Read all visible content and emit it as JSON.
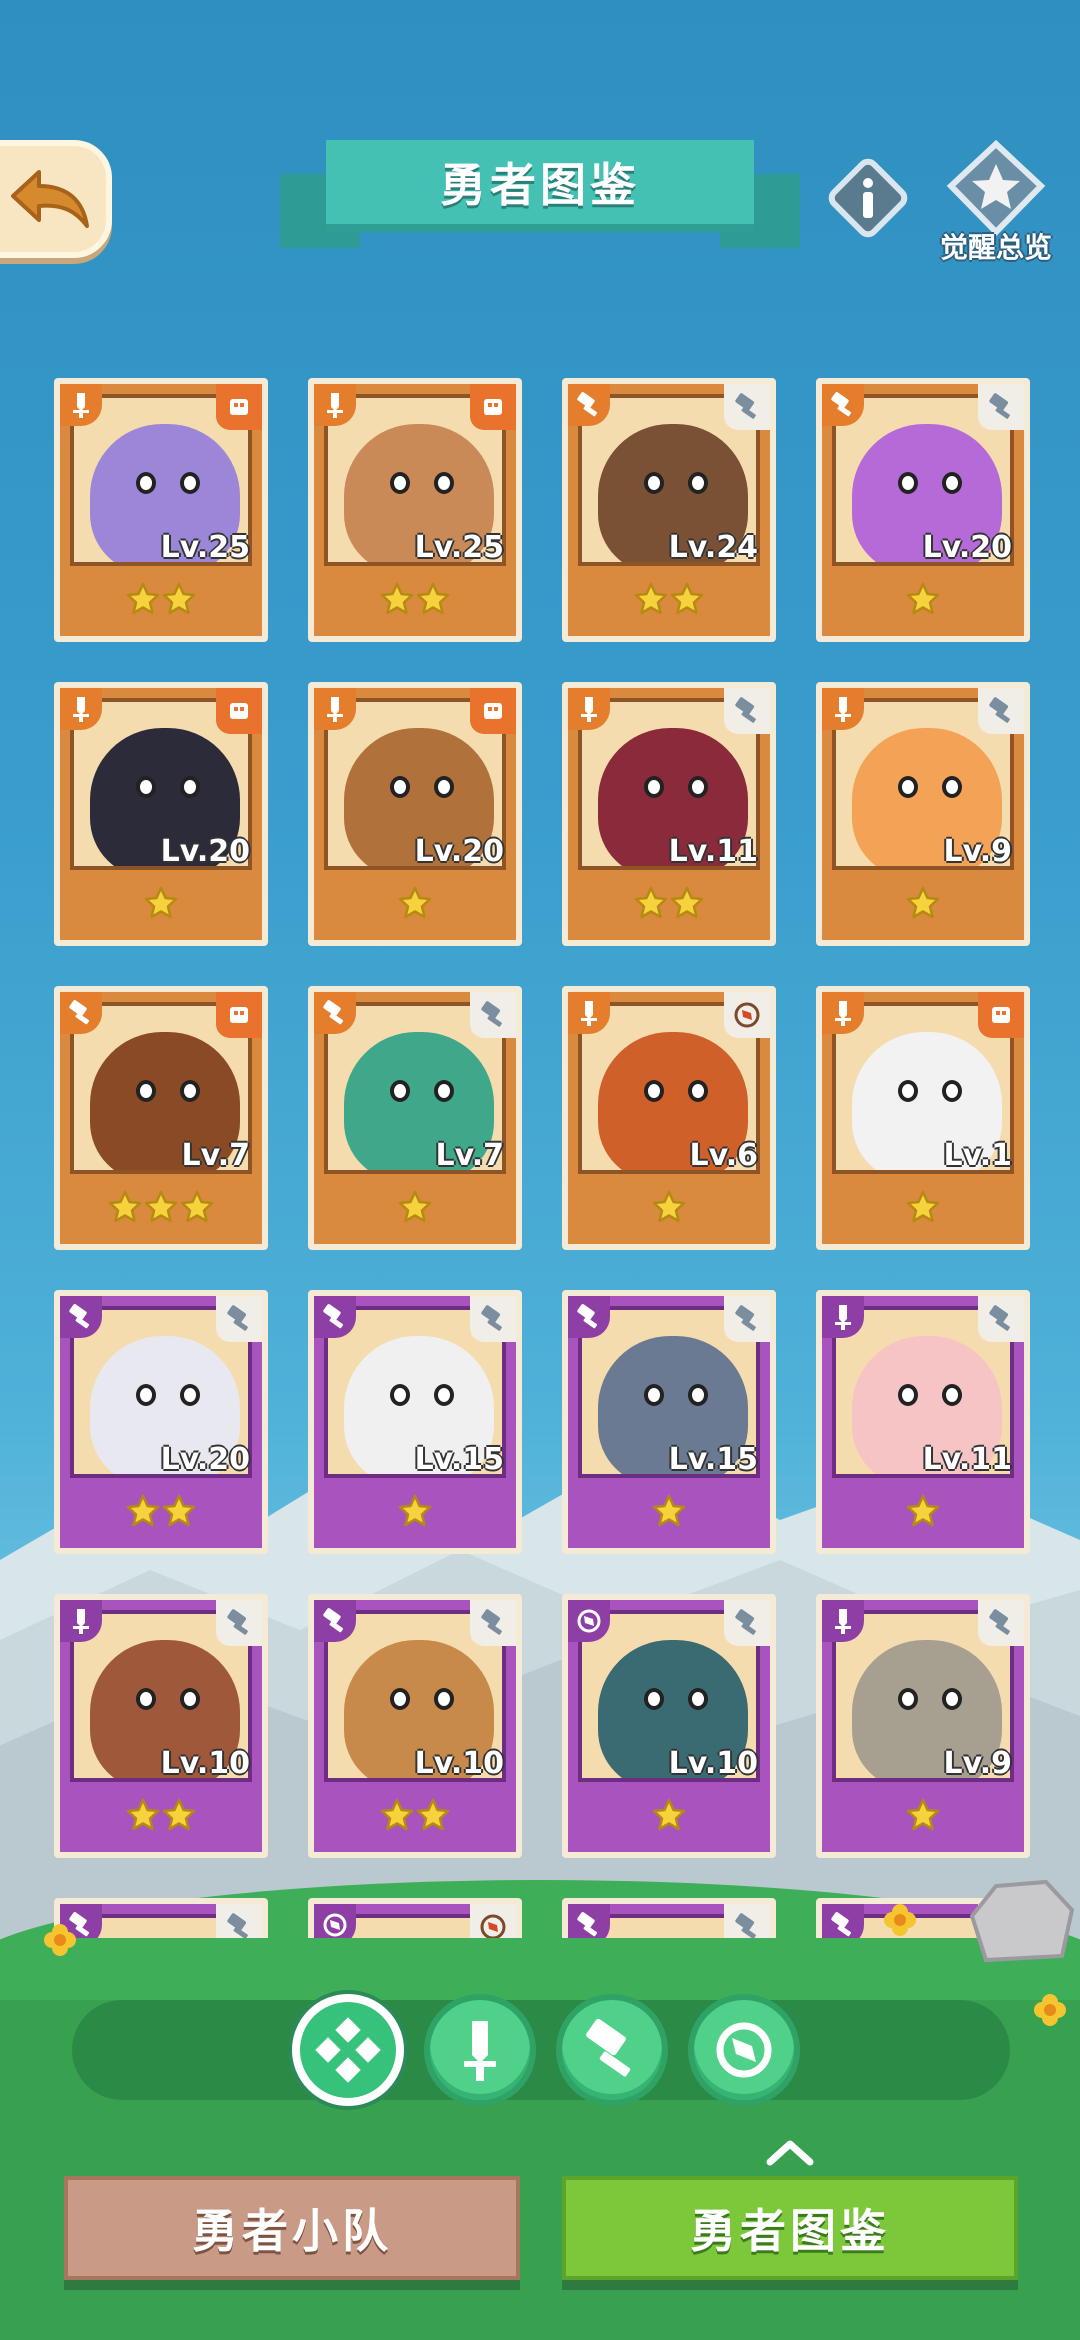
{
  "header": {
    "title": "勇者图鉴",
    "awaken_label": "觉醒总览"
  },
  "colors": {
    "card_orange": "#d98a3e",
    "card_purple": "#a953be",
    "star": "#f6d23c",
    "header_teal": "#45c1b4",
    "tab_active": "#7dc83a",
    "tab_inactive": "#c99a85"
  },
  "heroes": [
    {
      "level": "Lv.25",
      "stars": 2,
      "rarity": "orange",
      "role": "sword-icon",
      "class": "mask-icon",
      "creature_color": "#9b86d8"
    },
    {
      "level": "Lv.25",
      "stars": 2,
      "rarity": "orange",
      "role": "sword-icon",
      "class": "mask-icon",
      "creature_color": "#c98a58"
    },
    {
      "level": "Lv.24",
      "stars": 2,
      "rarity": "orange",
      "role": "hammer-icon",
      "class": "hammer-icon",
      "creature_color": "#7a5134"
    },
    {
      "level": "Lv.20",
      "stars": 1,
      "rarity": "orange",
      "role": "hammer-icon",
      "class": "hammer-icon",
      "creature_color": "#b66ad8"
    },
    {
      "level": "Lv.20",
      "stars": 1,
      "rarity": "orange",
      "role": "sword-icon",
      "class": "mask-icon",
      "creature_color": "#2b2b3a"
    },
    {
      "level": "Lv.20",
      "stars": 1,
      "rarity": "orange",
      "role": "sword-icon",
      "class": "mask-icon",
      "creature_color": "#b0723a"
    },
    {
      "level": "Lv.11",
      "stars": 2,
      "rarity": "orange",
      "role": "sword-icon",
      "class": "hammer-icon",
      "creature_color": "#8a2a3a"
    },
    {
      "level": "Lv.9",
      "stars": 1,
      "rarity": "orange",
      "role": "sword-icon",
      "class": "hammer-icon",
      "creature_color": "#f4a256"
    },
    {
      "level": "Lv.7",
      "stars": 3,
      "rarity": "orange",
      "role": "hammer-icon",
      "class": "mask-icon",
      "creature_color": "#8a4a25"
    },
    {
      "level": "Lv.7",
      "stars": 1,
      "rarity": "orange",
      "role": "hammer-icon",
      "class": "hammer-icon",
      "creature_color": "#3fa78a"
    },
    {
      "level": "Lv.6",
      "stars": 1,
      "rarity": "orange",
      "role": "sword-icon",
      "class": "compass-icon",
      "creature_color": "#d0602a"
    },
    {
      "level": "Lv.1",
      "stars": 1,
      "rarity": "orange",
      "role": "sword-icon",
      "class": "mask-icon",
      "creature_color": "#f2f2f2"
    },
    {
      "level": "Lv.20",
      "stars": 2,
      "rarity": "purple",
      "role": "hammer-icon",
      "class": "hammer-icon",
      "creature_color": "#e8e8f0"
    },
    {
      "level": "Lv.15",
      "stars": 1,
      "rarity": "purple",
      "role": "hammer-icon",
      "class": "hammer-icon",
      "creature_color": "#f0f0f0"
    },
    {
      "level": "Lv.15",
      "stars": 1,
      "rarity": "purple",
      "role": "hammer-icon",
      "class": "hammer-icon",
      "creature_color": "#6a7a92"
    },
    {
      "level": "Lv.11",
      "stars": 1,
      "rarity": "purple",
      "role": "sword-icon",
      "class": "hammer-icon",
      "creature_color": "#f6c4c4"
    },
    {
      "level": "Lv.10",
      "stars": 2,
      "rarity": "purple",
      "role": "sword-icon",
      "class": "hammer-icon",
      "creature_color": "#a0583a"
    },
    {
      "level": "Lv.10",
      "stars": 2,
      "rarity": "purple",
      "role": "hammer-icon",
      "class": "hammer-icon",
      "creature_color": "#c78a4a"
    },
    {
      "level": "Lv.10",
      "stars": 1,
      "rarity": "purple",
      "role": "compass-icon",
      "class": "hammer-icon",
      "creature_color": "#3a6a72"
    },
    {
      "level": "Lv.9",
      "stars": 1,
      "rarity": "purple",
      "role": "sword-icon",
      "class": "hammer-icon",
      "creature_color": "#a7a090"
    },
    {
      "level": "",
      "stars": 0,
      "rarity": "purple",
      "role": "hammer-icon",
      "class": "hammer-icon",
      "creature_color": "#4a4a6a"
    },
    {
      "level": "",
      "stars": 0,
      "rarity": "purple",
      "role": "compass-icon",
      "class": "compass-icon",
      "creature_color": "#6a3a2a"
    },
    {
      "level": "",
      "stars": 0,
      "rarity": "purple",
      "role": "hammer-icon",
      "class": "hammer-icon",
      "creature_color": "#3a3a4a"
    },
    {
      "level": "",
      "stars": 0,
      "rarity": "purple",
      "role": "hammer-icon",
      "class": "hammer-icon",
      "creature_color": "#4a6a8a"
    }
  ],
  "filters": [
    {
      "name": "all-filter",
      "icon": "grid-diamond-icon",
      "active": true
    },
    {
      "name": "sword-filter",
      "icon": "sword-icon",
      "active": false
    },
    {
      "name": "hammer-filter",
      "icon": "hammer-icon",
      "active": false
    },
    {
      "name": "compass-filter",
      "icon": "compass-icon",
      "active": false
    }
  ],
  "tabs": {
    "team": "勇者小队",
    "album": "勇者图鉴"
  }
}
